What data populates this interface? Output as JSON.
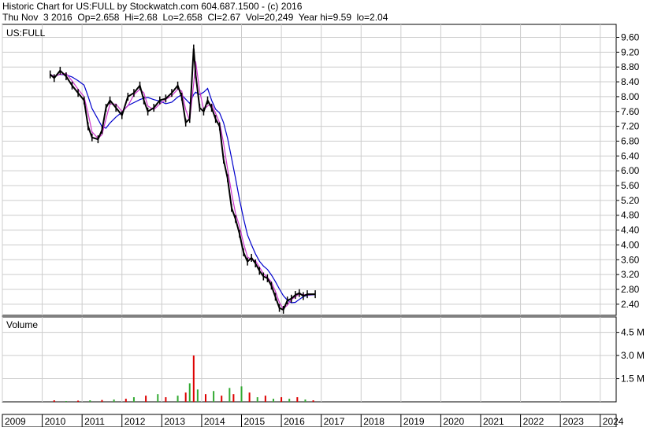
{
  "header": {
    "line1": "Historic Chart for US:FULL by Stockwatch.com 604.687.1500 - (c) 2016",
    "line2": "Thu Nov  3 2016  Op=2.658  Hi=2.68  Lo=2.658  Cl=2.67  Vol=20,249  Year hi=9.59  lo=2.04"
  },
  "chart_data": {
    "type": "line",
    "symbol": "US:FULL",
    "price_ticks": [
      "9.60",
      "9.20",
      "8.80",
      "8.40",
      "8.00",
      "7.60",
      "7.20",
      "6.80",
      "6.40",
      "6.00",
      "5.60",
      "5.20",
      "4.80",
      "4.40",
      "4.00",
      "3.60",
      "3.20",
      "2.80",
      "2.40"
    ],
    "volume_label": "Volume",
    "volume_ticks": [
      "4.5 M",
      "3.0 M",
      "1.5 M"
    ],
    "years": [
      "2009",
      "2010",
      "2011",
      "2012",
      "2013",
      "2014",
      "2015",
      "2016",
      "2017",
      "2018",
      "2019",
      "2020",
      "2021",
      "2022",
      "2023",
      "2024"
    ],
    "price_ylim": [
      2.1,
      9.95
    ],
    "volume_ylim": [
      0,
      5.5
    ],
    "x_range": [
      2009.0,
      2024.4
    ],
    "price_series": [
      [
        2010.2,
        8.6
      ],
      [
        2010.3,
        8.5
      ],
      [
        2010.45,
        8.7
      ],
      [
        2010.6,
        8.55
      ],
      [
        2010.75,
        8.3
      ],
      [
        2010.9,
        8.1
      ],
      [
        2011.05,
        7.9
      ],
      [
        2011.15,
        7.2
      ],
      [
        2011.25,
        6.9
      ],
      [
        2011.4,
        6.85
      ],
      [
        2011.5,
        7.1
      ],
      [
        2011.6,
        7.7
      ],
      [
        2011.7,
        7.9
      ],
      [
        2011.85,
        7.7
      ],
      [
        2012.0,
        7.5
      ],
      [
        2012.15,
        8.0
      ],
      [
        2012.3,
        8.1
      ],
      [
        2012.45,
        8.3
      ],
      [
        2012.55,
        7.9
      ],
      [
        2012.65,
        7.6
      ],
      [
        2012.8,
        7.7
      ],
      [
        2012.95,
        7.9
      ],
      [
        2013.1,
        7.95
      ],
      [
        2013.25,
        8.1
      ],
      [
        2013.4,
        8.3
      ],
      [
        2013.5,
        8.0
      ],
      [
        2013.6,
        7.3
      ],
      [
        2013.7,
        7.4
      ],
      [
        2013.8,
        9.3
      ],
      [
        2013.85,
        8.6
      ],
      [
        2013.95,
        7.7
      ],
      [
        2014.05,
        7.6
      ],
      [
        2014.15,
        7.9
      ],
      [
        2014.25,
        7.7
      ],
      [
        2014.35,
        7.4
      ],
      [
        2014.45,
        7.2
      ],
      [
        2014.55,
        6.3
      ],
      [
        2014.65,
        5.8
      ],
      [
        2014.75,
        5.0
      ],
      [
        2014.85,
        4.7
      ],
      [
        2014.95,
        4.3
      ],
      [
        2015.05,
        3.8
      ],
      [
        2015.15,
        3.55
      ],
      [
        2015.25,
        3.65
      ],
      [
        2015.35,
        3.5
      ],
      [
        2015.45,
        3.3
      ],
      [
        2015.55,
        3.15
      ],
      [
        2015.65,
        3.1
      ],
      [
        2015.75,
        2.9
      ],
      [
        2015.85,
        2.6
      ],
      [
        2015.95,
        2.3
      ],
      [
        2016.05,
        2.25
      ],
      [
        2016.15,
        2.5
      ],
      [
        2016.25,
        2.55
      ],
      [
        2016.35,
        2.65
      ],
      [
        2016.45,
        2.7
      ],
      [
        2016.55,
        2.62
      ],
      [
        2016.65,
        2.67
      ],
      [
        2016.85,
        2.67
      ]
    ],
    "volume_series": [
      [
        2010.3,
        0.1
      ],
      [
        2010.6,
        0.05
      ],
      [
        2010.9,
        0.08
      ],
      [
        2011.2,
        0.1
      ],
      [
        2011.5,
        0.12
      ],
      [
        2011.8,
        0.15
      ],
      [
        2012.1,
        0.2
      ],
      [
        2012.3,
        0.3
      ],
      [
        2012.6,
        0.4
      ],
      [
        2012.9,
        0.5
      ],
      [
        2013.1,
        0.3
      ],
      [
        2013.4,
        0.4
      ],
      [
        2013.6,
        0.6
      ],
      [
        2013.7,
        1.2
      ],
      [
        2013.8,
        3.0
      ],
      [
        2013.9,
        0.8
      ],
      [
        2014.1,
        0.5
      ],
      [
        2014.3,
        0.7
      ],
      [
        2014.5,
        0.4
      ],
      [
        2014.7,
        0.9
      ],
      [
        2014.8,
        0.5
      ],
      [
        2015.0,
        1.0
      ],
      [
        2015.2,
        0.6
      ],
      [
        2015.4,
        0.3
      ],
      [
        2015.6,
        0.4
      ],
      [
        2015.8,
        0.2
      ],
      [
        2016.0,
        0.3
      ],
      [
        2016.2,
        0.2
      ],
      [
        2016.4,
        0.3
      ],
      [
        2016.6,
        0.15
      ],
      [
        2016.8,
        0.1
      ]
    ]
  }
}
